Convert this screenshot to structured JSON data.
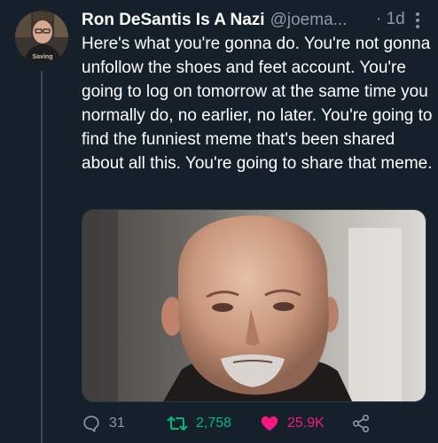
{
  "tweet": {
    "display_name": "Ron DeSantis Is A Nazi",
    "handle": "@joema...",
    "separator": "·",
    "time": "1d",
    "text": "Here's what you're gonna do. You're not gonna unfollow the shoes and feet account. You're going to log on tomorrow at the same time you normally do, no earlier, no later. You're going to find the funniest meme that's been shared about all this. You're going to share that meme.",
    "avatar_shirt_text": "Saving"
  },
  "actions": {
    "replies": "31",
    "retweets": "2,758",
    "likes": "25.9K"
  },
  "colors": {
    "background": "#15202b",
    "secondary_text": "#8b98a5",
    "retweet_green": "#00ba7c",
    "like_pink": "#f91880"
  },
  "icons": {
    "reply": "comment-bubble-icon",
    "retweet": "retweet-arrows-icon",
    "like": "heart-filled-icon",
    "share": "share-nodes-icon",
    "more": "vertical-ellipsis-icon"
  }
}
